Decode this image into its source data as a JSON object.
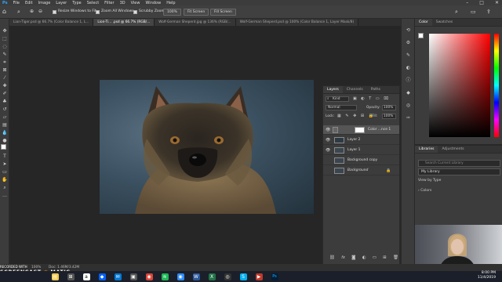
{
  "menu": [
    "Ps",
    "File",
    "Edit",
    "Image",
    "Layer",
    "Type",
    "Select",
    "Filter",
    "3D",
    "View",
    "Window",
    "Help"
  ],
  "window_controls": [
    "–",
    "□",
    "✕"
  ],
  "options_bar": {
    "resize_windows_label": "Resize Windows to Fit",
    "zoom_all_label": "Zoom All Windows",
    "scrubby_zoom_label": "Scrubby Zoom",
    "zoom_level": "100%",
    "fit_screen": "Fit Screen",
    "fill_screen": "Fill Screen"
  },
  "tabs": [
    "Lion-Tiger.psd @ 66.7% (Color Balance 1, L...",
    "Lion-Ti... .psd @ 66.7% (RGB/...",
    "Wolf-German Sheperd.jpg @ 136% (RGB/...",
    "Wolf-German Sheperd.psd @ 100% (Color Balance 1, Layer Mask/8)"
  ],
  "color_panel": {
    "tabs": [
      "Color",
      "Swatches"
    ]
  },
  "libraries_panel": {
    "tabs": [
      "Libraries",
      "Adjustments"
    ],
    "search_placeholder": "Search Current Library",
    "library_name": "My Library",
    "view_by": "View by Type",
    "section": "Colors"
  },
  "layers_panel": {
    "tabs": [
      "Layers",
      "Channels",
      "Paths"
    ],
    "kind_label": "Kind",
    "blend_mode": "Normal",
    "opacity_label": "Opacity:",
    "opacity_value": "100%",
    "lock_label": "Lock:",
    "fill_label": "Fill:",
    "fill_value": "100%",
    "layers": [
      {
        "name": "Color ...nce 1",
        "visible": true,
        "selected": true
      },
      {
        "name": "Layer 2",
        "visible": true,
        "selected": false
      },
      {
        "name": "Layer 1",
        "visible": true,
        "selected": false
      },
      {
        "name": "Background copy",
        "visible": false,
        "selected": false
      },
      {
        "name": "Background",
        "visible": false,
        "selected": false
      }
    ],
    "bottom_icons": [
      "link-icon",
      "fx-icon",
      "mask-icon",
      "adjustment-icon",
      "group-icon",
      "new-layer-icon",
      "trash-icon"
    ]
  },
  "status": {
    "zoom": "100%",
    "doc_size": "Doc: 1.46M/3.42M"
  },
  "watermark": {
    "line1": "SCREENCAST",
    "line2": "MATIC",
    "small": "RECORDED WITH"
  },
  "taskbar": {
    "time": "8:00 PM",
    "date": "11/4/2019"
  }
}
